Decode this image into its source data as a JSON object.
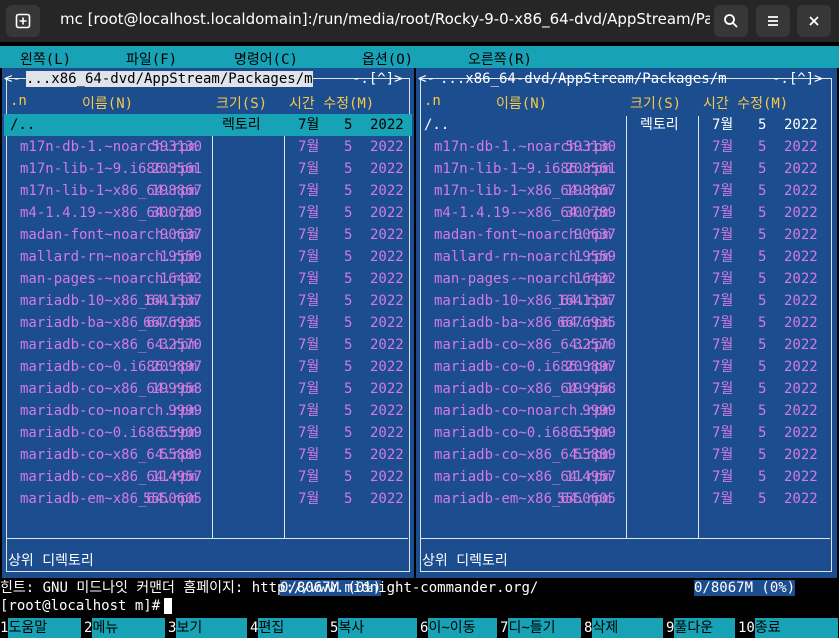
{
  "window": {
    "title": "mc [root@localhost.localdomain]:/run/media/root/Rocky-9-0-x86_64-dvd/AppStream/Pac…",
    "new_tab_icon": "new-tab-icon",
    "search_icon": "search-icon",
    "menu_icon": "hamburger-menu-icon",
    "close_icon": "close-icon"
  },
  "menubar": [
    "왼쪽(L)",
    "파일(F)",
    "명령어(C)",
    "옵션(O)",
    "오른쪽(R)"
  ],
  "left_panel": {
    "corner_left": "<-",
    "path": " ...x86_64-dvd/AppStream/Packages/m ",
    "corner_right": "-.[^]>",
    "headers": {
      "n": ".n",
      "name": "이름(N)",
      "size": "크기(S)",
      "time": "시간 수정(M)"
    },
    "updir": {
      "name": "/..",
      "size": "렉토리",
      "month": "7월",
      "day": "5",
      "year": "2022"
    },
    "mini_status": "상위 디렉토리",
    "usage": "0/8067M (0%)"
  },
  "right_panel": {
    "corner_left": "<-",
    "path": " ...x86_64-dvd/AppStream/Packages/m ",
    "corner_right": "-.[^]>",
    "headers": {
      "n": ".n",
      "name": "이름(N)",
      "size": "크기(S)",
      "time": "시간 수정(M)"
    },
    "updir": {
      "name": "/..",
      "size": "렉토리",
      "month": "7월",
      "day": "5",
      "year": "2022"
    },
    "mini_status": "상위 디렉토리",
    "usage": "0/8067M (0%)"
  },
  "files": [
    {
      "name": "m17n-db-1.~noarch.rpm",
      "size": "593130",
      "month": "7월",
      "day": "5",
      "year": "2022"
    },
    {
      "name": "m17n-lib-1~9.i686.rpm",
      "size": "208561",
      "month": "7월",
      "day": "5",
      "year": "2022"
    },
    {
      "name": "m17n-lib-1~x86_64.rpm",
      "size": "198867",
      "month": "7월",
      "day": "5",
      "year": "2022"
    },
    {
      "name": "m4-1.4.19-~x86_64.rpm",
      "size": "300789",
      "month": "7월",
      "day": "5",
      "year": "2022"
    },
    {
      "name": "madan-font~noarch.rpm",
      "size": "90637",
      "month": "7월",
      "day": "5",
      "year": "2022"
    },
    {
      "name": "mallard-rn~noarch.rpm",
      "size": "19559",
      "month": "7월",
      "day": "5",
      "year": "2022"
    },
    {
      "name": "man-pages-~noarch.rpm",
      "size": "16432",
      "month": "7월",
      "day": "5",
      "year": "2022"
    },
    {
      "name": "mariadb-10~x86_64.rpm",
      "size": "1641337",
      "month": "7월",
      "day": "5",
      "year": "2022"
    },
    {
      "name": "mariadb-ba~x86_64.rpm",
      "size": "6676935",
      "month": "7월",
      "day": "5",
      "year": "2022"
    },
    {
      "name": "mariadb-co~x86_64.rpm",
      "size": "32570",
      "month": "7월",
      "day": "5",
      "year": "2022"
    },
    {
      "name": "mariadb-co~0.i686.rpm",
      "size": "209897",
      "month": "7월",
      "day": "5",
      "year": "2022"
    },
    {
      "name": "mariadb-co~x86_64.rpm",
      "size": "199958",
      "month": "7월",
      "day": "5",
      "year": "2022"
    },
    {
      "name": "mariadb-co~noarch.rpm",
      "size": "9999",
      "month": "7월",
      "day": "5",
      "year": "2022"
    },
    {
      "name": "mariadb-co~0.i686.rpm",
      "size": "55909",
      "month": "7월",
      "day": "5",
      "year": "2022"
    },
    {
      "name": "mariadb-co~x86_64.rpm",
      "size": "55889",
      "month": "7월",
      "day": "5",
      "year": "2022"
    },
    {
      "name": "mariadb-co~x86_64.rpm",
      "size": "114957",
      "month": "7월",
      "day": "5",
      "year": "2022"
    },
    {
      "name": "mariadb-em~x86_64.rpm",
      "size": "5550605",
      "month": "7월",
      "day": "5",
      "year": "2022"
    }
  ],
  "hint": "힌트: GNU 미드나잇 커맨더 홈페이지: http://www.midnight-commander.org/",
  "prompt": "[root@localhost m]#",
  "fkeys": [
    {
      "num": "1",
      "label": "도움말"
    },
    {
      "num": "2",
      "label": "메뉴"
    },
    {
      "num": "3",
      "label": "보기"
    },
    {
      "num": "4",
      "label": "편집"
    },
    {
      "num": "5",
      "label": "복사"
    },
    {
      "num": "6",
      "label": "이~이동"
    },
    {
      "num": "7",
      "label": "디~들기"
    },
    {
      "num": "8",
      "label": "삭제"
    },
    {
      "num": "9",
      "label": "풀다운"
    },
    {
      "num": "10",
      "label": "종료"
    }
  ],
  "colors": {
    "panel_bg": "#1c4d8e",
    "accent": "#17a2b5",
    "file_fg": "#d37be0",
    "header_fg": "#f6c84a"
  }
}
